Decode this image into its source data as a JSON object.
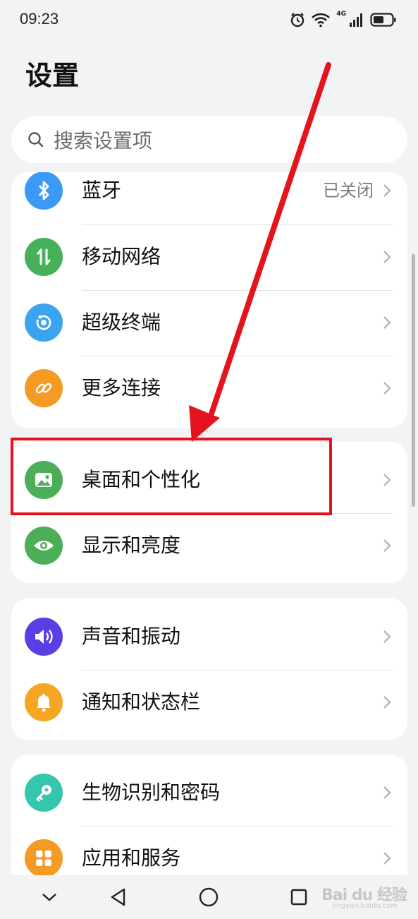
{
  "status_bar": {
    "time": "09:23",
    "network_label": "4G"
  },
  "page_title": "设置",
  "search": {
    "placeholder": "搜索设置项"
  },
  "groups": [
    {
      "items": [
        {
          "label": "蓝牙",
          "value": "已关闭",
          "icon": "bluetooth-icon",
          "color": "#3b9af5"
        },
        {
          "label": "移动网络",
          "icon": "mobile-data-icon",
          "color": "#46b05a"
        },
        {
          "label": "超级终端",
          "icon": "super-device-icon",
          "color": "#3aa4ef"
        },
        {
          "label": "更多连接",
          "icon": "link-icon",
          "color": "#f59a23"
        }
      ]
    },
    {
      "items": [
        {
          "label": "桌面和个性化",
          "icon": "image-icon",
          "color": "#4cae57"
        },
        {
          "label": "显示和亮度",
          "icon": "eye-icon",
          "color": "#4cae57"
        }
      ]
    },
    {
      "items": [
        {
          "label": "声音和振动",
          "icon": "speaker-icon",
          "color": "#5a3fe6"
        },
        {
          "label": "通知和状态栏",
          "icon": "bell-icon",
          "color": "#f5a623"
        }
      ]
    },
    {
      "items": [
        {
          "label": "生物识别和密码",
          "icon": "key-icon",
          "color": "#35c7ae"
        },
        {
          "label": "应用和服务",
          "icon": "apps-icon",
          "color": "#f59a23"
        }
      ]
    }
  ],
  "annotation": {
    "color": "#e4141e"
  },
  "watermark": {
    "brand": "Bai du 经验",
    "sub": "jingyan.baidu.com"
  }
}
